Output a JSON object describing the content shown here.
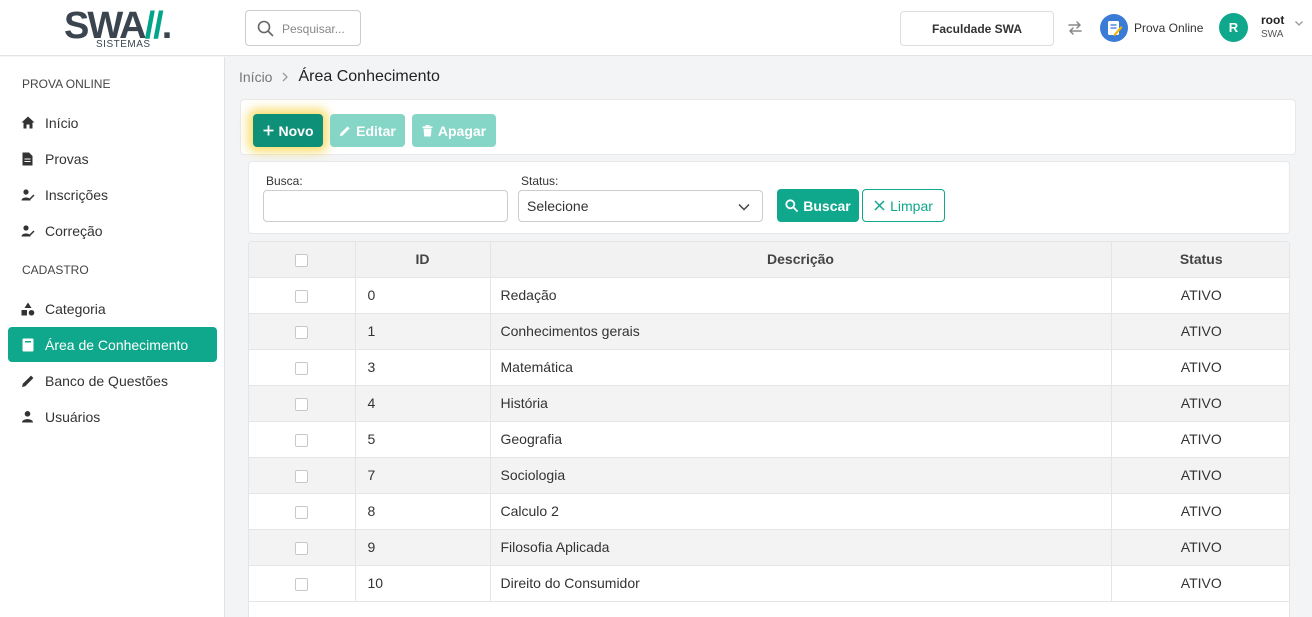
{
  "header": {
    "logo_text": "SWA",
    "logo_accent": "//",
    "logo_dot": ".",
    "logo_sub": "SISTEMAS",
    "search_placeholder": "Pesquisar...",
    "institution": "Faculdade SWA",
    "app_name": "Prova Online",
    "user_initial": "R",
    "user_name": "root",
    "user_org": "SWA"
  },
  "sidebar": {
    "sections": [
      {
        "title": "PROVA ONLINE",
        "items": [
          {
            "label": "Início",
            "icon": "home-icon"
          },
          {
            "label": "Provas",
            "icon": "document-icon"
          },
          {
            "label": "Inscrições",
            "icon": "user-write-icon"
          },
          {
            "label": "Correção",
            "icon": "user-write-icon"
          }
        ]
      },
      {
        "title": "CADASTRO",
        "items": [
          {
            "label": "Categoria",
            "icon": "shapes-icon"
          },
          {
            "label": "Área de Conhecimento",
            "icon": "book-icon",
            "active": true
          },
          {
            "label": "Banco de Questões",
            "icon": "pencil-icon"
          },
          {
            "label": "Usuários",
            "icon": "user-icon"
          }
        ]
      }
    ]
  },
  "breadcrumb": {
    "home": "Início",
    "current": "Área Conhecimento"
  },
  "toolbar": {
    "new_label": "Novo",
    "edit_label": "Editar",
    "delete_label": "Apagar"
  },
  "filters": {
    "search_label": "Busca:",
    "search_value": "",
    "status_label": "Status:",
    "status_selected": "Selecione",
    "search_button": "Buscar",
    "clear_button": "Limpar"
  },
  "table": {
    "columns": [
      "",
      "ID",
      "Descrição",
      "Status"
    ],
    "rows": [
      {
        "id": "0",
        "desc": "Redação",
        "status": "ATIVO"
      },
      {
        "id": "1",
        "desc": "Conhecimentos gerais",
        "status": "ATIVO"
      },
      {
        "id": "3",
        "desc": "Matemática",
        "status": "ATIVO"
      },
      {
        "id": "4",
        "desc": "História",
        "status": "ATIVO"
      },
      {
        "id": "5",
        "desc": "Geografia",
        "status": "ATIVO"
      },
      {
        "id": "7",
        "desc": "Sociologia",
        "status": "ATIVO"
      },
      {
        "id": "8",
        "desc": "Calculo 2",
        "status": "ATIVO"
      },
      {
        "id": "9",
        "desc": "Filosofia Aplicada",
        "status": "ATIVO"
      },
      {
        "id": "10",
        "desc": "Direito do Consumidor",
        "status": "ATIVO"
      }
    ]
  },
  "colors": {
    "primary": "#0fa88c",
    "primary_dark": "#0e8f78",
    "disabled": "#86d6c8",
    "highlight_glow": "#f7d33c"
  }
}
